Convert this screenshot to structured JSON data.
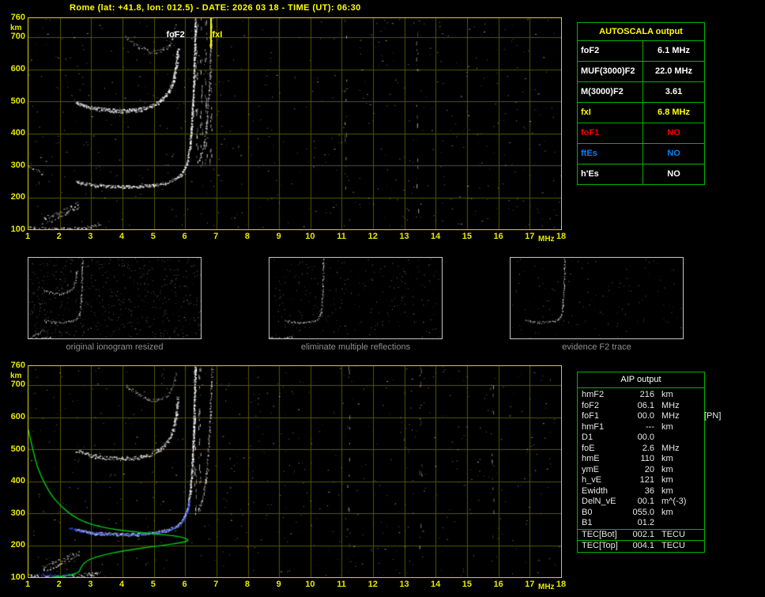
{
  "title": "Rome (lat: +41.8, lon: 012.5) - DATE: 2026 03 18 - TIME (UT): 06:30",
  "colors": {
    "background": "#000000",
    "title_text": "#ffff00",
    "plot_border": "#d6d600",
    "grid": "#565600",
    "axis_text": "#e8e800",
    "echo_dots": "#ffffff",
    "table_border": "#00b400",
    "profile_green": "#00c814",
    "trace_blue": "#3355ff",
    "fxi_marker": "#ffff00",
    "caption_gray": "#8f8f8f",
    "no_red": "#ff0000",
    "no_blue": "#0080ff"
  },
  "autoscala_table": {
    "header": "AUTOSCALA output",
    "rows": [
      {
        "label": "foF2",
        "value": "6.1 MHz",
        "color": "#ffffff"
      },
      {
        "label": "MUF(3000)F2",
        "value": "22.0 MHz",
        "color": "#ffffff"
      },
      {
        "label": "M(3000)F2",
        "value": "3.61",
        "color": "#ffffff"
      },
      {
        "label": "fxI",
        "value": "6.8 MHz",
        "color": "#ffff00"
      },
      {
        "label": "foF1",
        "value": "NO",
        "color": "#ff0000"
      },
      {
        "label": "ftEs",
        "value": "NO",
        "color": "#0080ff"
      },
      {
        "label": "h'Es",
        "value": "NO",
        "color": "#ffffff"
      }
    ]
  },
  "aip_table": {
    "header": "AIP output",
    "rows": [
      {
        "label": "hmF2",
        "value": "216",
        "unit": "km",
        "note": ""
      },
      {
        "label": "foF2",
        "value": "06.1",
        "unit": "MHz",
        "note": ""
      },
      {
        "label": "foF1",
        "value": "00.0",
        "unit": "MHz",
        "note": "[PN]"
      },
      {
        "label": "hmF1",
        "value": "---",
        "unit": "km",
        "note": ""
      },
      {
        "label": "D1",
        "value": "00.0",
        "unit": "",
        "note": ""
      },
      {
        "label": "foE",
        "value": "2.6",
        "unit": "MHz",
        "note": ""
      },
      {
        "label": "hmE",
        "value": "110",
        "unit": "km",
        "note": ""
      },
      {
        "label": "ymE",
        "value": "20",
        "unit": "km",
        "note": ""
      },
      {
        "label": "h_vE",
        "value": "121",
        "unit": "km",
        "note": ""
      },
      {
        "label": "Ewidth",
        "value": "36",
        "unit": "km",
        "note": ""
      },
      {
        "label": "DelN_vE",
        "value": "00.1",
        "unit": "m^(-3)",
        "note": ""
      },
      {
        "label": "B0",
        "value": "055.0",
        "unit": "km",
        "note": ""
      },
      {
        "label": "B1",
        "value": "01.2",
        "unit": "",
        "note": ""
      }
    ],
    "tec_rows": [
      {
        "label": "TEC[Bot]",
        "value": "002.1",
        "unit": "TECU"
      },
      {
        "label": "TEC[Top]",
        "value": "004.1",
        "unit": "TECU"
      }
    ]
  },
  "thumbnails": [
    {
      "caption": "original ionogram resized"
    },
    {
      "caption": "eliminate multiple reflections"
    },
    {
      "caption": "evidence F2 trace"
    }
  ],
  "chart_data": [
    {
      "type": "scatter",
      "name": "ionogram with autoscaled characteristics",
      "x_axis": {
        "label": "MHz",
        "range": [
          1,
          18
        ],
        "ticks": [
          1,
          2,
          3,
          4,
          5,
          6,
          7,
          8,
          9,
          10,
          11,
          12,
          13,
          14,
          15,
          16,
          17,
          18
        ]
      },
      "y_axis": {
        "label": "km",
        "range": [
          100,
          760
        ],
        "ticks": [
          760,
          700,
          600,
          500,
          400,
          300,
          200,
          100
        ]
      },
      "grid": true,
      "annotations": [
        {
          "text": "foF2",
          "mhz": 5.42,
          "color": "#ffffff"
        },
        {
          "text": "fxI",
          "mhz": 6.88,
          "color": "#ffff00"
        }
      ],
      "marker_line": {
        "mhz": 6.8,
        "from_km": 760,
        "to_km": 665,
        "color": "#ffff00"
      },
      "scaled_values": {
        "foF2_MHz": 6.1,
        "fxI_MHz": 6.8,
        "MUF3000F2_MHz": 22.0,
        "M3000F2": 3.61
      },
      "traces": {
        "E_region": [
          [
            1.0,
            105
          ],
          [
            1.4,
            102
          ],
          [
            1.8,
            100
          ],
          [
            2.2,
            101
          ],
          [
            2.6,
            105
          ],
          [
            3.0,
            110
          ],
          [
            3.3,
            119
          ]
        ],
        "Es_patch": [
          [
            1.45,
            128
          ],
          [
            1.9,
            143
          ],
          [
            2.3,
            161
          ],
          [
            2.6,
            178
          ]
        ],
        "LF_spread": [
          [
            1.0,
            302
          ],
          [
            1.25,
            287
          ],
          [
            1.5,
            273
          ]
        ],
        "F2_first_hop": [
          [
            2.5,
            249
          ],
          [
            3.0,
            240
          ],
          [
            3.5,
            236
          ],
          [
            4.0,
            234
          ],
          [
            4.5,
            235
          ],
          [
            5.0,
            239
          ],
          [
            5.4,
            247
          ],
          [
            5.7,
            259
          ],
          [
            5.9,
            276
          ],
          [
            6.05,
            306
          ],
          [
            6.15,
            362
          ],
          [
            6.22,
            455
          ],
          [
            6.27,
            565
          ],
          [
            6.3,
            685
          ],
          [
            6.32,
            760
          ]
        ],
        "F2_second_hop": [
          [
            2.5,
            495
          ],
          [
            3.0,
            481
          ],
          [
            3.5,
            473
          ],
          [
            4.0,
            471
          ],
          [
            4.5,
            475
          ],
          [
            4.9,
            485
          ],
          [
            5.2,
            501
          ],
          [
            5.45,
            527
          ],
          [
            5.6,
            562
          ],
          [
            5.7,
            612
          ],
          [
            5.75,
            662
          ]
        ],
        "F2_third_hop": [
          [
            4.1,
            700
          ],
          [
            4.5,
            672
          ],
          [
            4.9,
            655
          ],
          [
            5.2,
            658
          ],
          [
            5.45,
            672
          ],
          [
            5.6,
            700
          ],
          [
            5.7,
            740
          ]
        ],
        "X_mode": [
          [
            6.4,
            310
          ],
          [
            6.55,
            345
          ],
          [
            6.65,
            400
          ],
          [
            6.72,
            480
          ],
          [
            6.78,
            575
          ],
          [
            6.82,
            680
          ],
          [
            6.85,
            760
          ]
        ],
        "spread_streaks_mhz": [
          6.35,
          6.5,
          6.65,
          6.8,
          11.1,
          13.4
        ]
      }
    },
    {
      "type": "scatter+line",
      "name": "ionogram with restored trace and electron density profile",
      "x_axis": {
        "label": "MHz",
        "range": [
          1,
          18
        ],
        "ticks": [
          1,
          2,
          3,
          4,
          5,
          6,
          7,
          8,
          9,
          10,
          11,
          12,
          13,
          14,
          15,
          16,
          17,
          18
        ]
      },
      "y_axis": {
        "label": "km",
        "range": [
          100,
          760
        ],
        "ticks": [
          760,
          700,
          600,
          500,
          400,
          300,
          200,
          100
        ]
      },
      "grid": true,
      "traces": {
        "E_region": [
          [
            1.0,
            105
          ],
          [
            1.4,
            102
          ],
          [
            1.8,
            100
          ],
          [
            2.2,
            101
          ],
          [
            2.6,
            105
          ],
          [
            3.0,
            110
          ],
          [
            3.3,
            119
          ]
        ],
        "Es_patch": [
          [
            1.45,
            128
          ],
          [
            1.9,
            143
          ],
          [
            2.3,
            161
          ],
          [
            2.6,
            178
          ]
        ],
        "F2_first_hop": [
          [
            2.5,
            249
          ],
          [
            3.0,
            240
          ],
          [
            3.5,
            236
          ],
          [
            4.0,
            234
          ],
          [
            4.5,
            235
          ],
          [
            5.0,
            239
          ],
          [
            5.4,
            247
          ],
          [
            5.7,
            259
          ],
          [
            5.9,
            276
          ],
          [
            6.05,
            306
          ],
          [
            6.15,
            362
          ],
          [
            6.22,
            455
          ],
          [
            6.27,
            565
          ],
          [
            6.3,
            685
          ],
          [
            6.32,
            760
          ]
        ],
        "F2_second_hop": [
          [
            2.5,
            495
          ],
          [
            3.0,
            481
          ],
          [
            3.5,
            473
          ],
          [
            4.0,
            471
          ],
          [
            4.5,
            475
          ],
          [
            4.9,
            485
          ],
          [
            5.2,
            501
          ],
          [
            5.45,
            527
          ],
          [
            5.6,
            562
          ],
          [
            5.7,
            612
          ],
          [
            5.75,
            662
          ]
        ],
        "F2_third_hop": [
          [
            4.1,
            700
          ],
          [
            4.5,
            672
          ],
          [
            4.9,
            655
          ],
          [
            5.2,
            658
          ],
          [
            5.45,
            672
          ],
          [
            5.6,
            700
          ],
          [
            5.7,
            740
          ]
        ],
        "X_mode": [
          [
            6.4,
            310
          ],
          [
            6.55,
            345
          ],
          [
            6.65,
            400
          ],
          [
            6.72,
            480
          ],
          [
            6.78,
            575
          ],
          [
            6.82,
            680
          ],
          [
            6.85,
            760
          ]
        ],
        "spread_streaks_mhz": [
          6.3,
          6.45,
          11.2,
          13.5,
          15.8
        ]
      },
      "restored_trace_blue": [
        [
          2.3,
          256
        ],
        [
          2.6,
          247
        ],
        [
          3.0,
          240
        ],
        [
          3.5,
          236
        ],
        [
          4.0,
          234
        ],
        [
          4.5,
          236
        ],
        [
          5.0,
          240
        ],
        [
          5.4,
          247
        ],
        [
          5.7,
          258
        ],
        [
          5.9,
          273
        ],
        [
          6.0,
          293
        ],
        [
          6.08,
          318
        ],
        [
          6.13,
          342
        ]
      ],
      "restored_E_blue": [
        [
          1.35,
          113
        ],
        [
          1.7,
          107
        ],
        [
          2.05,
          104
        ],
        [
          2.4,
          112
        ]
      ],
      "density_profile_green": [
        [
          1.0,
          560
        ],
        [
          1.2,
          470
        ],
        [
          1.4,
          415
        ],
        [
          1.7,
          360
        ],
        [
          2.0,
          325
        ],
        [
          2.4,
          292
        ],
        [
          2.8,
          272
        ],
        [
          3.2,
          260
        ],
        [
          3.6,
          252
        ],
        [
          4.0,
          246
        ],
        [
          4.4,
          242
        ],
        [
          4.8,
          238
        ],
        [
          5.2,
          234
        ],
        [
          5.6,
          230
        ],
        [
          5.9,
          225
        ],
        [
          6.05,
          220
        ],
        [
          6.1,
          216
        ],
        [
          6.05,
          212
        ],
        [
          5.8,
          207
        ],
        [
          5.4,
          201
        ],
        [
          4.9,
          195
        ],
        [
          4.4,
          188
        ],
        [
          3.9,
          180
        ],
        [
          3.4,
          170
        ],
        [
          3.0,
          158
        ],
        [
          2.8,
          147
        ],
        [
          2.7,
          135
        ],
        [
          2.65,
          124
        ],
        [
          2.6,
          115
        ],
        [
          2.45,
          110
        ],
        [
          2.2,
          105
        ],
        [
          1.9,
          101
        ],
        [
          1.5,
          96
        ],
        [
          1.1,
          92
        ],
        [
          1.0,
          90
        ]
      ],
      "profile_values": {
        "hmF2_km": 216,
        "foF2_MHz": 6.1,
        "foE_MHz": 2.6,
        "hmE_km": 110
      }
    }
  ]
}
